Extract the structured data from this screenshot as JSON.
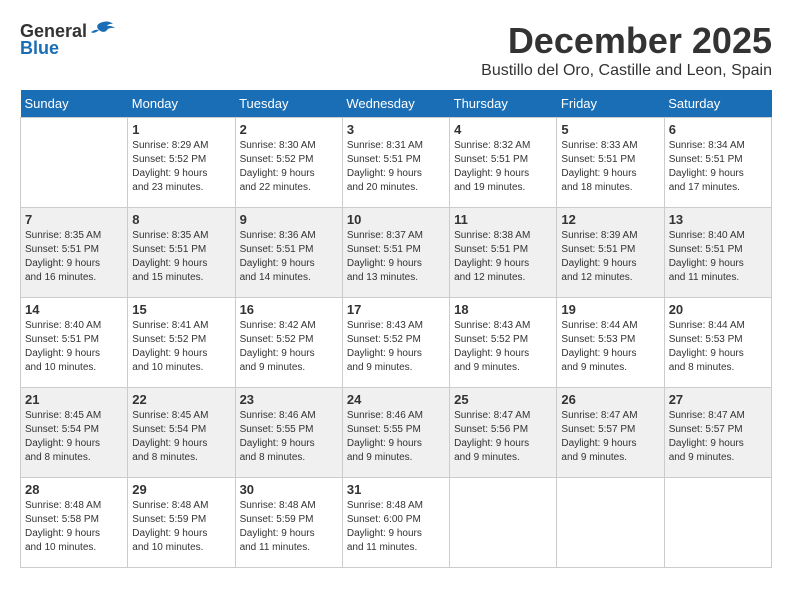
{
  "logo": {
    "general": "General",
    "blue": "Blue"
  },
  "title": "December 2025",
  "location": "Bustillo del Oro, Castille and Leon, Spain",
  "days_of_week": [
    "Sunday",
    "Monday",
    "Tuesday",
    "Wednesday",
    "Thursday",
    "Friday",
    "Saturday"
  ],
  "weeks": [
    [
      {
        "day": "",
        "sunrise": "",
        "sunset": "",
        "daylight": ""
      },
      {
        "day": "1",
        "sunrise": "Sunrise: 8:29 AM",
        "sunset": "Sunset: 5:52 PM",
        "daylight": "Daylight: 9 hours and 23 minutes."
      },
      {
        "day": "2",
        "sunrise": "Sunrise: 8:30 AM",
        "sunset": "Sunset: 5:52 PM",
        "daylight": "Daylight: 9 hours and 22 minutes."
      },
      {
        "day": "3",
        "sunrise": "Sunrise: 8:31 AM",
        "sunset": "Sunset: 5:51 PM",
        "daylight": "Daylight: 9 hours and 20 minutes."
      },
      {
        "day": "4",
        "sunrise": "Sunrise: 8:32 AM",
        "sunset": "Sunset: 5:51 PM",
        "daylight": "Daylight: 9 hours and 19 minutes."
      },
      {
        "day": "5",
        "sunrise": "Sunrise: 8:33 AM",
        "sunset": "Sunset: 5:51 PM",
        "daylight": "Daylight: 9 hours and 18 minutes."
      },
      {
        "day": "6",
        "sunrise": "Sunrise: 8:34 AM",
        "sunset": "Sunset: 5:51 PM",
        "daylight": "Daylight: 9 hours and 17 minutes."
      }
    ],
    [
      {
        "day": "7",
        "sunrise": "Sunrise: 8:35 AM",
        "sunset": "Sunset: 5:51 PM",
        "daylight": "Daylight: 9 hours and 16 minutes."
      },
      {
        "day": "8",
        "sunrise": "Sunrise: 8:35 AM",
        "sunset": "Sunset: 5:51 PM",
        "daylight": "Daylight: 9 hours and 15 minutes."
      },
      {
        "day": "9",
        "sunrise": "Sunrise: 8:36 AM",
        "sunset": "Sunset: 5:51 PM",
        "daylight": "Daylight: 9 hours and 14 minutes."
      },
      {
        "day": "10",
        "sunrise": "Sunrise: 8:37 AM",
        "sunset": "Sunset: 5:51 PM",
        "daylight": "Daylight: 9 hours and 13 minutes."
      },
      {
        "day": "11",
        "sunrise": "Sunrise: 8:38 AM",
        "sunset": "Sunset: 5:51 PM",
        "daylight": "Daylight: 9 hours and 12 minutes."
      },
      {
        "day": "12",
        "sunrise": "Sunrise: 8:39 AM",
        "sunset": "Sunset: 5:51 PM",
        "daylight": "Daylight: 9 hours and 12 minutes."
      },
      {
        "day": "13",
        "sunrise": "Sunrise: 8:40 AM",
        "sunset": "Sunset: 5:51 PM",
        "daylight": "Daylight: 9 hours and 11 minutes."
      }
    ],
    [
      {
        "day": "14",
        "sunrise": "Sunrise: 8:40 AM",
        "sunset": "Sunset: 5:51 PM",
        "daylight": "Daylight: 9 hours and 10 minutes."
      },
      {
        "day": "15",
        "sunrise": "Sunrise: 8:41 AM",
        "sunset": "Sunset: 5:52 PM",
        "daylight": "Daylight: 9 hours and 10 minutes."
      },
      {
        "day": "16",
        "sunrise": "Sunrise: 8:42 AM",
        "sunset": "Sunset: 5:52 PM",
        "daylight": "Daylight: 9 hours and 9 minutes."
      },
      {
        "day": "17",
        "sunrise": "Sunrise: 8:43 AM",
        "sunset": "Sunset: 5:52 PM",
        "daylight": "Daylight: 9 hours and 9 minutes."
      },
      {
        "day": "18",
        "sunrise": "Sunrise: 8:43 AM",
        "sunset": "Sunset: 5:52 PM",
        "daylight": "Daylight: 9 hours and 9 minutes."
      },
      {
        "day": "19",
        "sunrise": "Sunrise: 8:44 AM",
        "sunset": "Sunset: 5:53 PM",
        "daylight": "Daylight: 9 hours and 9 minutes."
      },
      {
        "day": "20",
        "sunrise": "Sunrise: 8:44 AM",
        "sunset": "Sunset: 5:53 PM",
        "daylight": "Daylight: 9 hours and 8 minutes."
      }
    ],
    [
      {
        "day": "21",
        "sunrise": "Sunrise: 8:45 AM",
        "sunset": "Sunset: 5:54 PM",
        "daylight": "Daylight: 9 hours and 8 minutes."
      },
      {
        "day": "22",
        "sunrise": "Sunrise: 8:45 AM",
        "sunset": "Sunset: 5:54 PM",
        "daylight": "Daylight: 9 hours and 8 minutes."
      },
      {
        "day": "23",
        "sunrise": "Sunrise: 8:46 AM",
        "sunset": "Sunset: 5:55 PM",
        "daylight": "Daylight: 9 hours and 8 minutes."
      },
      {
        "day": "24",
        "sunrise": "Sunrise: 8:46 AM",
        "sunset": "Sunset: 5:55 PM",
        "daylight": "Daylight: 9 hours and 9 minutes."
      },
      {
        "day": "25",
        "sunrise": "Sunrise: 8:47 AM",
        "sunset": "Sunset: 5:56 PM",
        "daylight": "Daylight: 9 hours and 9 minutes."
      },
      {
        "day": "26",
        "sunrise": "Sunrise: 8:47 AM",
        "sunset": "Sunset: 5:57 PM",
        "daylight": "Daylight: 9 hours and 9 minutes."
      },
      {
        "day": "27",
        "sunrise": "Sunrise: 8:47 AM",
        "sunset": "Sunset: 5:57 PM",
        "daylight": "Daylight: 9 hours and 9 minutes."
      }
    ],
    [
      {
        "day": "28",
        "sunrise": "Sunrise: 8:48 AM",
        "sunset": "Sunset: 5:58 PM",
        "daylight": "Daylight: 9 hours and 10 minutes."
      },
      {
        "day": "29",
        "sunrise": "Sunrise: 8:48 AM",
        "sunset": "Sunset: 5:59 PM",
        "daylight": "Daylight: 9 hours and 10 minutes."
      },
      {
        "day": "30",
        "sunrise": "Sunrise: 8:48 AM",
        "sunset": "Sunset: 5:59 PM",
        "daylight": "Daylight: 9 hours and 11 minutes."
      },
      {
        "day": "31",
        "sunrise": "Sunrise: 8:48 AM",
        "sunset": "Sunset: 6:00 PM",
        "daylight": "Daylight: 9 hours and 11 minutes."
      },
      {
        "day": "",
        "sunrise": "",
        "sunset": "",
        "daylight": ""
      },
      {
        "day": "",
        "sunrise": "",
        "sunset": "",
        "daylight": ""
      },
      {
        "day": "",
        "sunrise": "",
        "sunset": "",
        "daylight": ""
      }
    ]
  ]
}
